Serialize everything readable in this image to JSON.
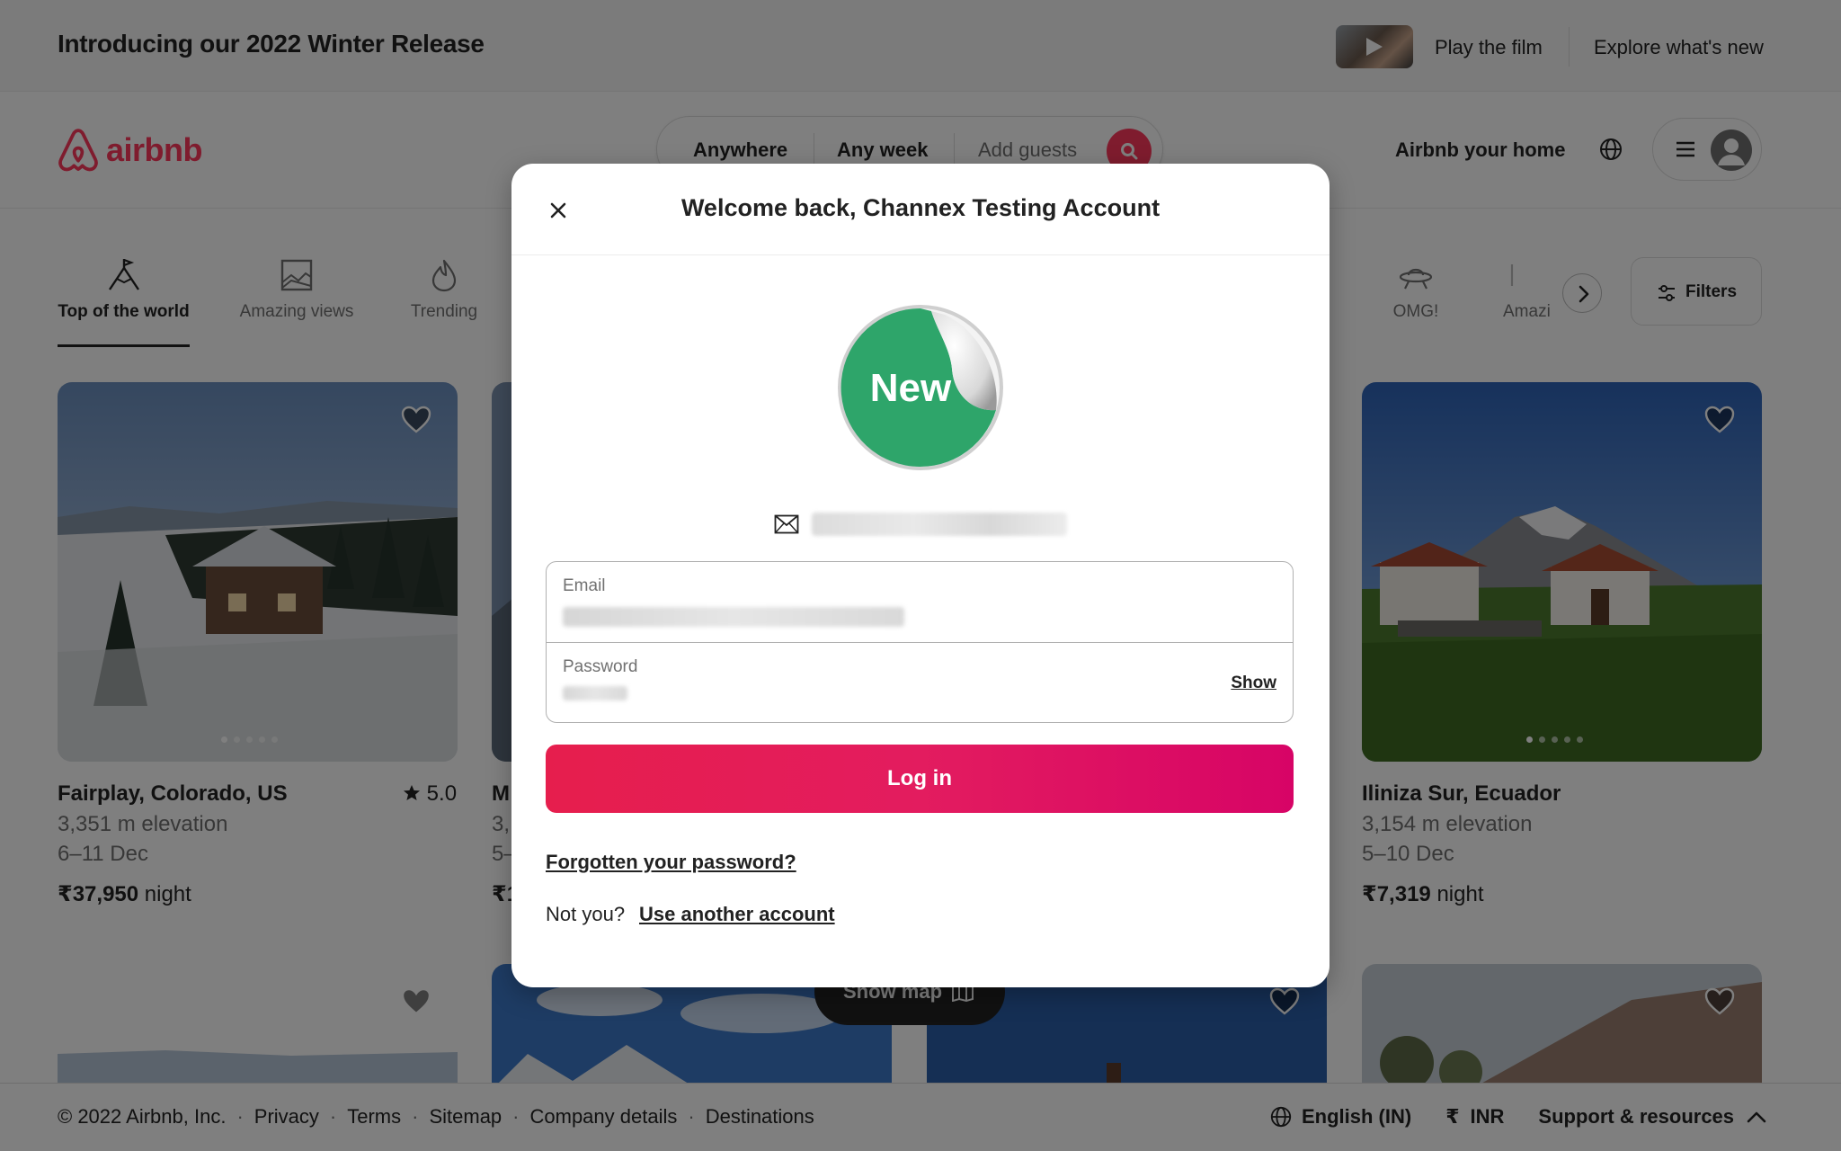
{
  "announcement": {
    "intro": "Introducing our 2022 Winter Release",
    "play_film": "Play the film",
    "explore": "Explore what's new"
  },
  "header": {
    "brand": "airbnb",
    "search": {
      "anywhere": "Anywhere",
      "any_week": "Any week",
      "add_guests": "Add guests"
    },
    "host_link": "Airbnb your home"
  },
  "categories": {
    "items": [
      {
        "label": "Top of the world",
        "icon": "mountain-flag-icon",
        "active": true
      },
      {
        "label": "Amazing views",
        "icon": "framed-landscape-icon",
        "active": false
      },
      {
        "label": "Trending",
        "icon": "flame-icon",
        "active": false
      },
      {
        "label": "OMG!",
        "icon": "ufo-icon",
        "active": false
      },
      {
        "label": "Amazi",
        "icon": "pool-icon",
        "active": false
      }
    ],
    "filters_label": "Filters"
  },
  "listings": [
    {
      "title": "Fairplay, Colorado, US",
      "rating": "5.0",
      "line1": "3,351 m elevation",
      "line2": "6–11 Dec",
      "price": "₹37,950",
      "price_unit": "night"
    },
    {
      "title": "M",
      "line1": "3,",
      "line2": "5–",
      "price": "₹1"
    },
    {
      "title": "Iliniza Sur, Ecuador",
      "line1": "3,154 m elevation",
      "line2": "5–10 Dec",
      "price": "₹7,319",
      "price_unit": "night"
    }
  ],
  "show_map": "Show map",
  "footer": {
    "copyright": "© 2022 Airbnb, Inc.",
    "links": [
      "Privacy",
      "Terms",
      "Sitemap",
      "Company details",
      "Destinations"
    ],
    "language": "English (IN)",
    "currency_symbol": "₹",
    "currency": "INR",
    "support": "Support & resources"
  },
  "modal": {
    "title": "Welcome back, Channex Testing Account",
    "badge_text": "New",
    "email_label": "Email",
    "password_label": "Password",
    "show_label": "Show",
    "login_label": "Log in",
    "forgot_label": "Forgotten your password?",
    "not_you": "Not you?",
    "another_account": "Use another account"
  },
  "colors": {
    "brand": "#ff385c",
    "login_start": "#e61e4d",
    "login_end": "#d70466",
    "badge_green": "#2ea56a"
  }
}
